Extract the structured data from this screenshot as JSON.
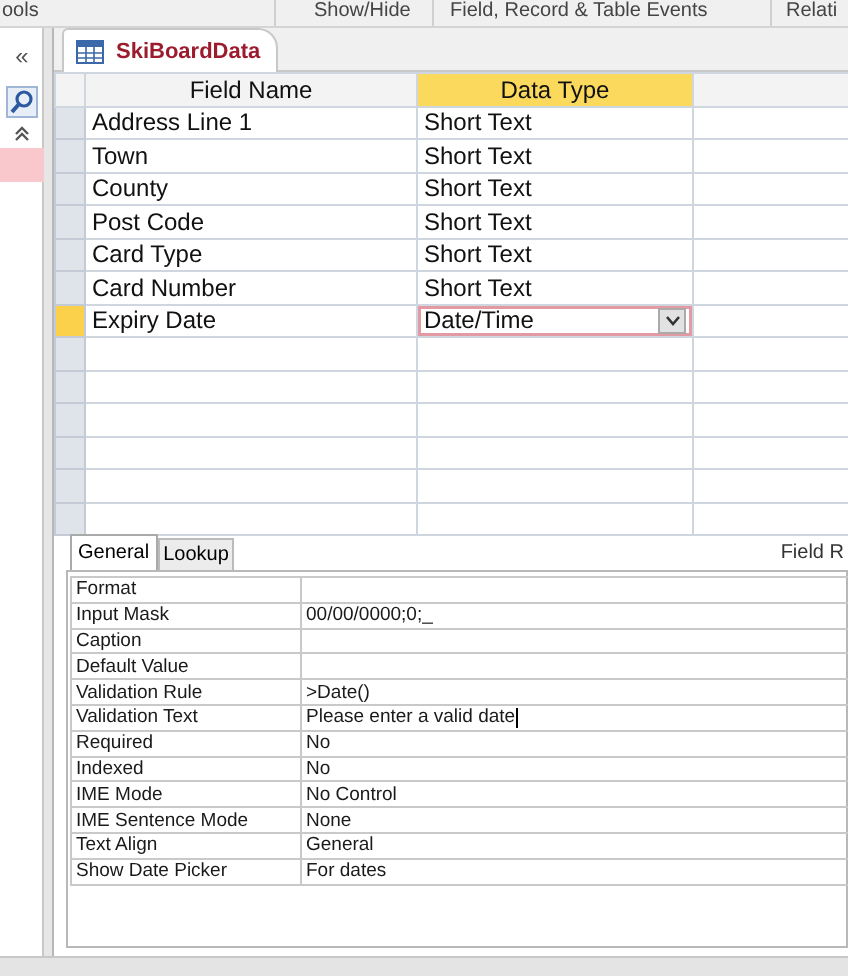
{
  "ribbon_groups": [
    "ools",
    "Show/Hide",
    "Field, Record & Table Events",
    "Relati"
  ],
  "nav_pane": {
    "collapse_button": "«"
  },
  "document_tab": {
    "label": "SkiBoardData",
    "selected": true
  },
  "grid": {
    "columns": [
      {
        "label": "Field Name",
        "selected": false
      },
      {
        "label": "Data Type",
        "selected": true
      }
    ],
    "rows": [
      {
        "field_name": "Address Line 1",
        "data_type": "Short Text",
        "selected": false
      },
      {
        "field_name": "Town",
        "data_type": "Short Text",
        "selected": false
      },
      {
        "field_name": "County",
        "data_type": "Short Text",
        "selected": false
      },
      {
        "field_name": "Post Code",
        "data_type": "Short Text",
        "selected": false
      },
      {
        "field_name": "Card Type",
        "data_type": "Short Text",
        "selected": false
      },
      {
        "field_name": "Card Number",
        "data_type": "Short Text",
        "selected": false
      },
      {
        "field_name": "Expiry Date",
        "data_type": "Date/Time",
        "selected": true
      }
    ]
  },
  "properties_label": "Field R",
  "property_tabs": [
    {
      "label": "General",
      "selected": true
    },
    {
      "label": "Lookup",
      "selected": false
    }
  ],
  "properties": [
    {
      "name": "Format",
      "focused": false
    },
    {
      "name": "Input Mask",
      "value": "00/00/0000;0;_",
      "focused": false
    },
    {
      "name": "Caption",
      "focused": false
    },
    {
      "name": "Default Value",
      "focused": false
    },
    {
      "name": "Validation Rule",
      "value": ">Date()",
      "focused": false
    },
    {
      "name": "Validation Text",
      "value": "Please enter a valid date",
      "focused": true
    },
    {
      "name": "Required",
      "value": "No",
      "focused": false
    },
    {
      "name": "Indexed",
      "value": "No",
      "focused": false
    },
    {
      "name": "IME Mode",
      "value": "No Control",
      "focused": false
    },
    {
      "name": "IME Sentence Mode",
      "value": "None",
      "focused": false
    },
    {
      "name": "Text Align",
      "value": "General",
      "focused": false
    },
    {
      "name": "Show Date Picker",
      "value": "For dates",
      "focused": false
    }
  ]
}
